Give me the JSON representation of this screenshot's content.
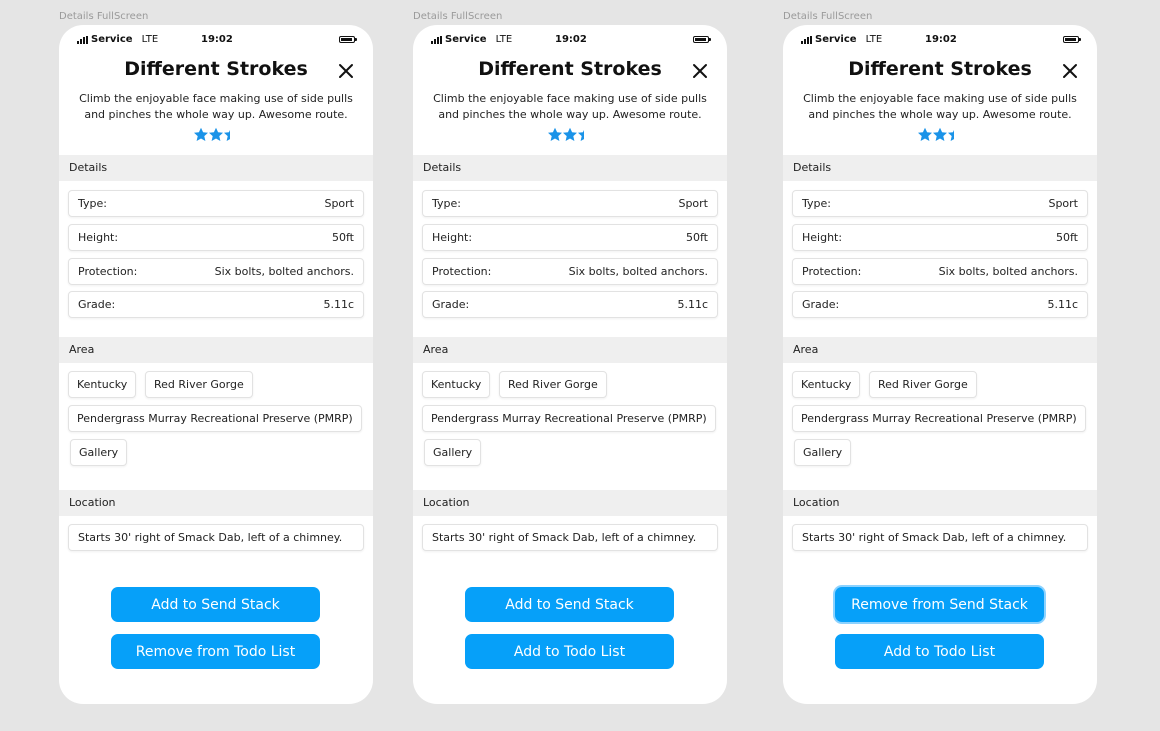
{
  "frames": [
    {
      "frame_label": "Details FullScreen",
      "status": {
        "carrier": "Service",
        "network": "LTE",
        "time": "19:02"
      },
      "title": "Different Strokes",
      "description": "Climb the enjoyable face making use of side pulls and pinches the whole way up. Awesome route.",
      "rating": 2.5,
      "details_header": "Details",
      "details": [
        {
          "label": "Type:",
          "value": "Sport"
        },
        {
          "label": "Height:",
          "value": "50ft"
        },
        {
          "label": "Protection:",
          "value": "Six bolts, bolted anchors."
        },
        {
          "label": "Grade:",
          "value": "5.11c"
        }
      ],
      "area_header": "Area",
      "area_tags": [
        "Kentucky",
        "Red River Gorge",
        "Pendergrass Murray Recreational Preserve (PMRP)",
        "Gallery"
      ],
      "location_header": "Location",
      "location": "Starts 30' right of Smack Dab, left of a chimney.",
      "primary_button": "Add to Send Stack",
      "secondary_button": "Remove from Todo List"
    },
    {
      "frame_label": "Details FullScreen",
      "status": {
        "carrier": "Service",
        "network": "LTE",
        "time": "19:02"
      },
      "title": "Different Strokes",
      "description": "Climb the enjoyable face making use of side pulls and pinches the whole way up. Awesome route.",
      "rating": 2.5,
      "details_header": "Details",
      "details": [
        {
          "label": "Type:",
          "value": "Sport"
        },
        {
          "label": "Height:",
          "value": "50ft"
        },
        {
          "label": "Protection:",
          "value": "Six bolts, bolted anchors."
        },
        {
          "label": "Grade:",
          "value": "5.11c"
        }
      ],
      "area_header": "Area",
      "area_tags": [
        "Kentucky",
        "Red River Gorge",
        "Pendergrass Murray Recreational Preserve (PMRP)",
        "Gallery"
      ],
      "location_header": "Location",
      "location": "Starts 30' right of Smack Dab, left of a chimney.",
      "primary_button": "Add to Send Stack",
      "secondary_button": "Add to Todo List"
    },
    {
      "frame_label": "Details FullScreen",
      "status": {
        "carrier": "Service",
        "network": "LTE",
        "time": "19:02"
      },
      "title": "Different Strokes",
      "description": "Climb the enjoyable face making use of side pulls and pinches the whole way up. Awesome route.",
      "rating": 2.5,
      "details_header": "Details",
      "details": [
        {
          "label": "Type:",
          "value": "Sport"
        },
        {
          "label": "Height:",
          "value": "50ft"
        },
        {
          "label": "Protection:",
          "value": "Six bolts, bolted anchors."
        },
        {
          "label": "Grade:",
          "value": "5.11c"
        }
      ],
      "area_header": "Area",
      "area_tags": [
        "Kentucky",
        "Red River Gorge",
        "Pendergrass Murray Recreational Preserve (PMRP)",
        "Gallery"
      ],
      "location_header": "Location",
      "location": "Starts 30' right of Smack Dab, left of a chimney.",
      "primary_button": "Remove from Send Stack",
      "secondary_button": "Add to Todo List"
    }
  ],
  "colors": {
    "accent": "#06a0f9",
    "star": "#1a93e8",
    "section_bg": "#efefef"
  }
}
